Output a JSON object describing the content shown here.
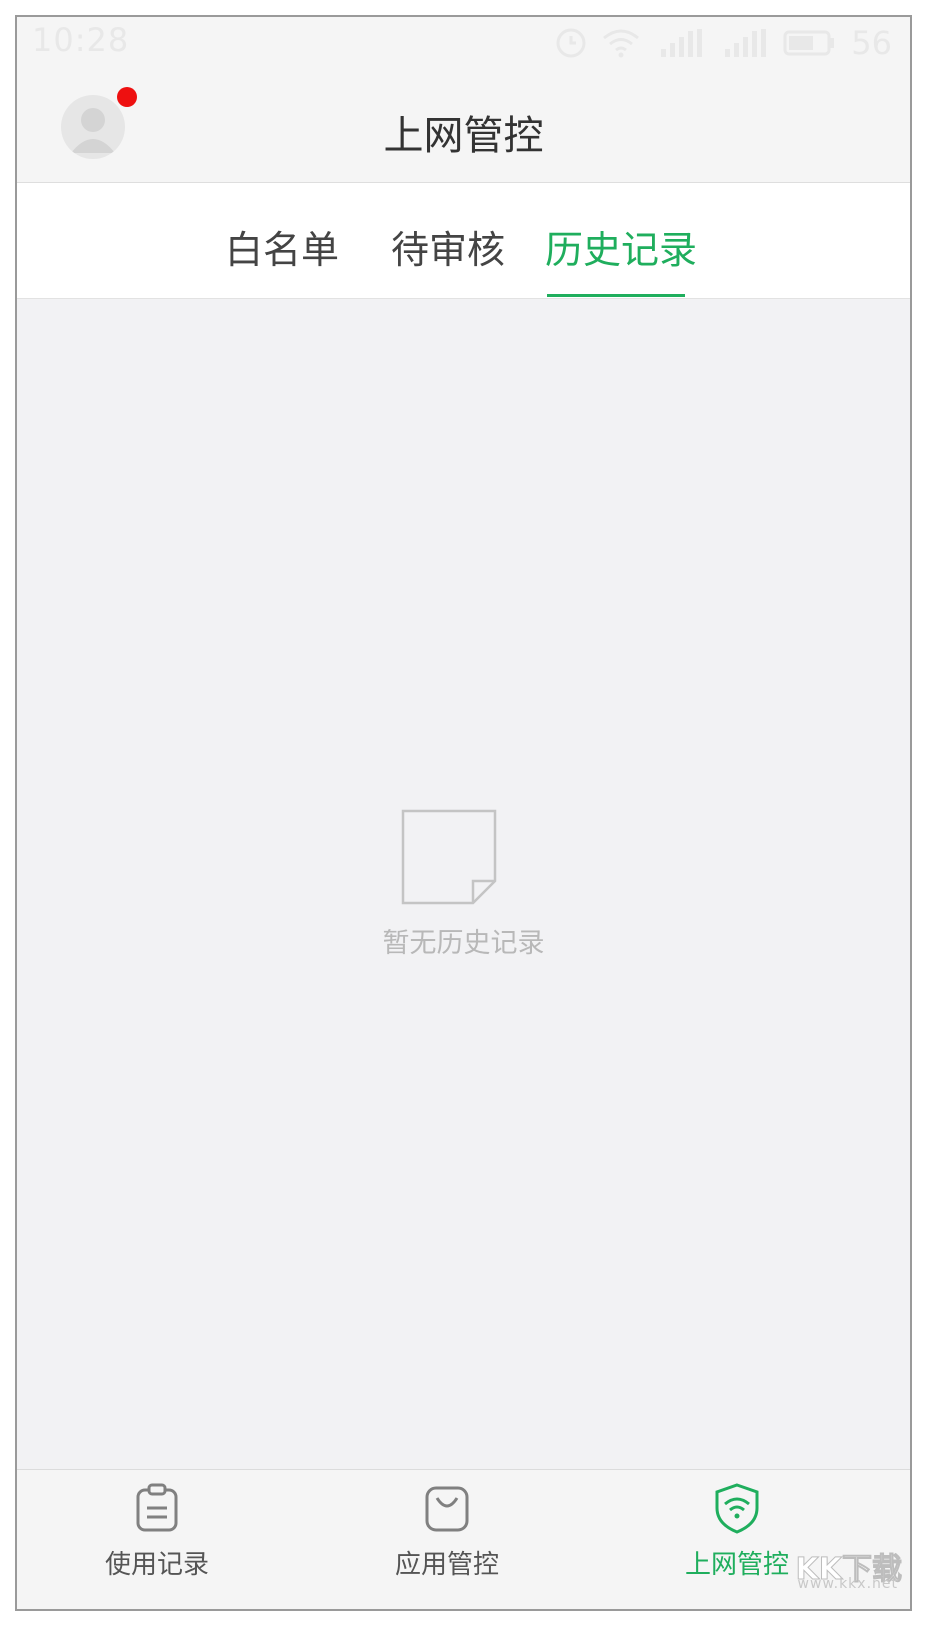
{
  "status_bar": {
    "time": "10:28",
    "battery": "56",
    "icons": [
      "alarm-icon",
      "wifi-icon",
      "signal-icon",
      "signal-icon",
      "battery-icon"
    ]
  },
  "header": {
    "title": "上网管控"
  },
  "tabs": [
    {
      "label": "白名单",
      "active": false
    },
    {
      "label": "待审核",
      "active": false
    },
    {
      "label": "历史记录",
      "active": true
    }
  ],
  "empty_state": {
    "icon": "blank-document-icon",
    "message": "暂无历史记录"
  },
  "bottom_nav": [
    {
      "label": "使用记录",
      "icon": "clipboard-icon",
      "active": false
    },
    {
      "label": "应用管控",
      "icon": "shopping-bag-icon",
      "active": false
    },
    {
      "label": "上网管控",
      "icon": "shield-wifi-icon",
      "active": true
    }
  ],
  "colors": {
    "accent": "#1fae5d",
    "badge": "#ee1010",
    "background": "#f2f2f4"
  },
  "watermark": {
    "logo": "KK下载",
    "site": "www.kkx.net"
  }
}
